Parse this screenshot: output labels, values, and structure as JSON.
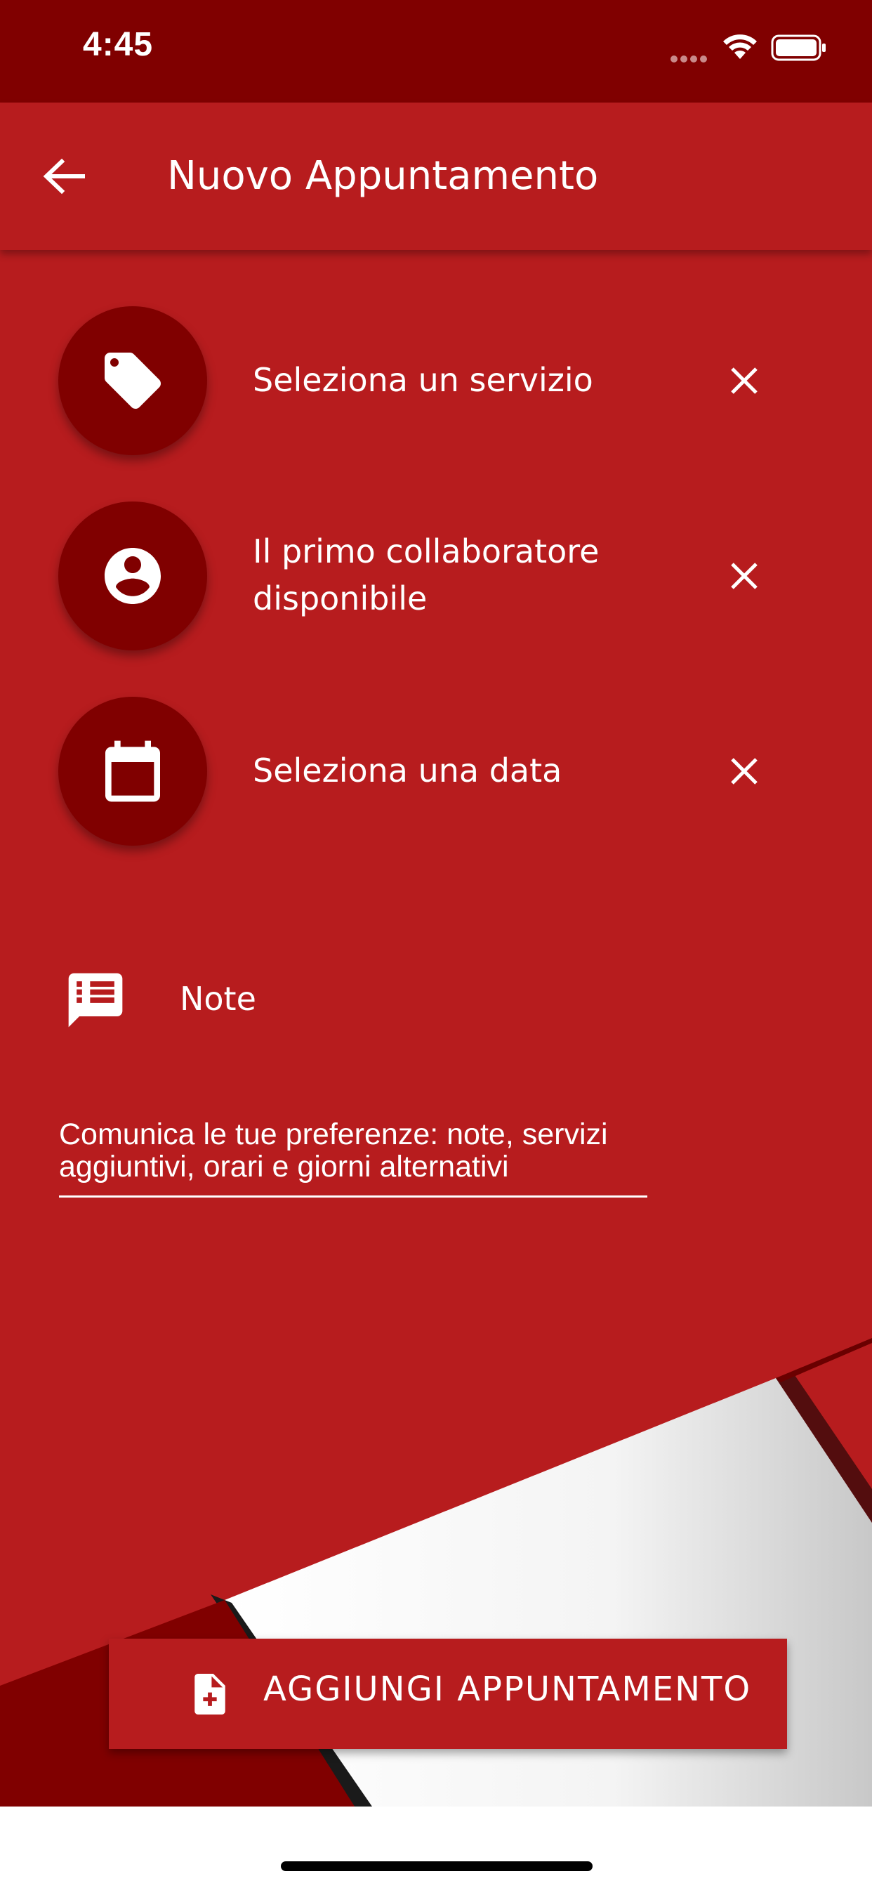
{
  "status_bar": {
    "time": "4:45"
  },
  "header": {
    "title": "Nuovo Appuntamento"
  },
  "items": [
    {
      "label": "Seleziona un servizio",
      "icon": "tag-icon"
    },
    {
      "label": "Il primo collaboratore disponibile",
      "icon": "account-circle-icon"
    },
    {
      "label": "Seleziona una data",
      "icon": "calendar-icon"
    }
  ],
  "notes": {
    "label": "Note",
    "placeholder": "Comunica le tue preferenze: note, servizi aggiuntivi, orari e giorni alternativi"
  },
  "action": {
    "label": "AGGIUNGI APPUNTAMENTO",
    "icon": "add-document-icon"
  },
  "colors": {
    "primary": "#b71c1e",
    "dark": "#800000",
    "text": "#ffffff"
  }
}
